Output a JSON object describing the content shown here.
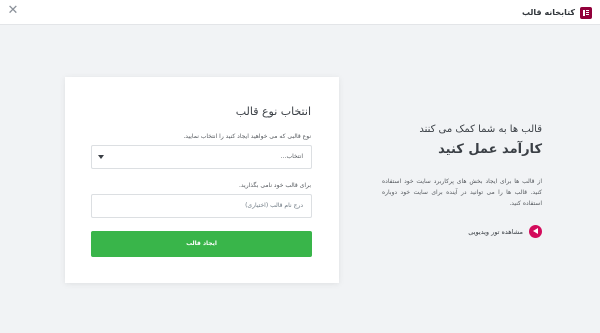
{
  "header": {
    "title": "کتابخانه قالب",
    "close_icon": "close-icon",
    "logo_icon": "elementor-logo-icon",
    "brand_color": "#92003b"
  },
  "form": {
    "title": "انتخاب نوع قالب",
    "type_label": "نوع قالبی که می خواهید ایجاد کنید را انتخاب نمایید.",
    "type_select_value": "انتخاب...",
    "name_label": "برای قالب خود نامی بگذارید.",
    "name_placeholder": "درج نام قالب (اختیاری)",
    "submit_label": "ایجاد قالب",
    "submit_color": "#39b54a"
  },
  "info": {
    "subtitle": "قالب ها به شما کمک می کنند",
    "headline": "کارآمد عمل کنید",
    "description": "از قالب ها برای ایجاد بخش های پرکاربرد سایت خود استفاده کنید. قالب ها را می توانید در آینده برای سایت خود دوباره استفاده کنید.",
    "video_label": "مشاهده تور ویدیویی",
    "video_icon": "play-icon",
    "accent_color": "#d30c5c"
  }
}
